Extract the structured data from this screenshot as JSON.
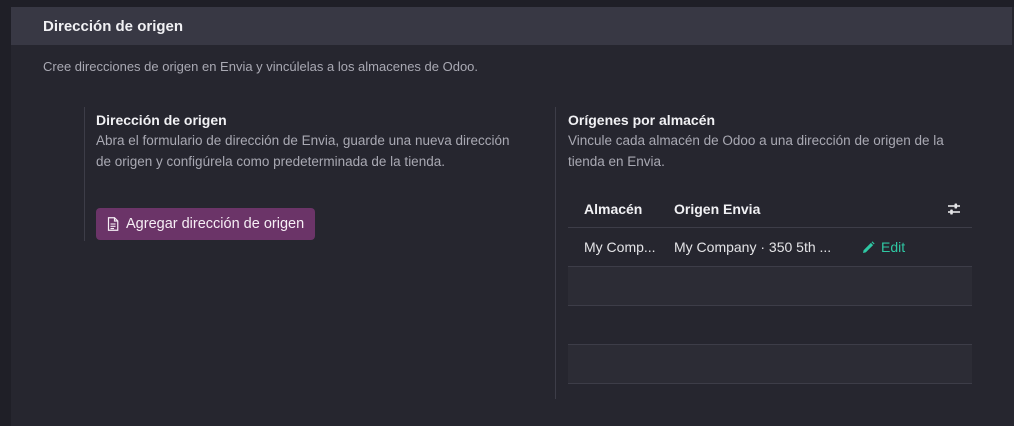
{
  "section": {
    "title": "Dirección de origen",
    "description": "Cree direcciones de origen en Envia y vincúlelas a los almacenes de Odoo."
  },
  "origin_block": {
    "title": "Dirección de origen",
    "description": "Abra el formulario de dirección de Envia, guarde una nueva dirección de origen y configúrela como predeterminada de la tienda.",
    "button_label": "Agregar dirección de origen",
    "button_icon": "document-icon",
    "button_color": "#6b3468"
  },
  "warehouse_block": {
    "title": "Orígenes por almacén",
    "description": "Vincule cada almacén de Odoo a una dirección de origen de la tienda en Envia.",
    "table": {
      "columns": [
        "Almacén",
        "Origen Envia"
      ],
      "settings_icon": "sliders-icon",
      "rows": [
        {
          "almacen": "My Comp...",
          "origen": "My Company · 350 5th ...",
          "action_label": "Edit",
          "action_icon": "pencil-icon"
        }
      ],
      "accent_color": "#2fc7a3"
    }
  }
}
